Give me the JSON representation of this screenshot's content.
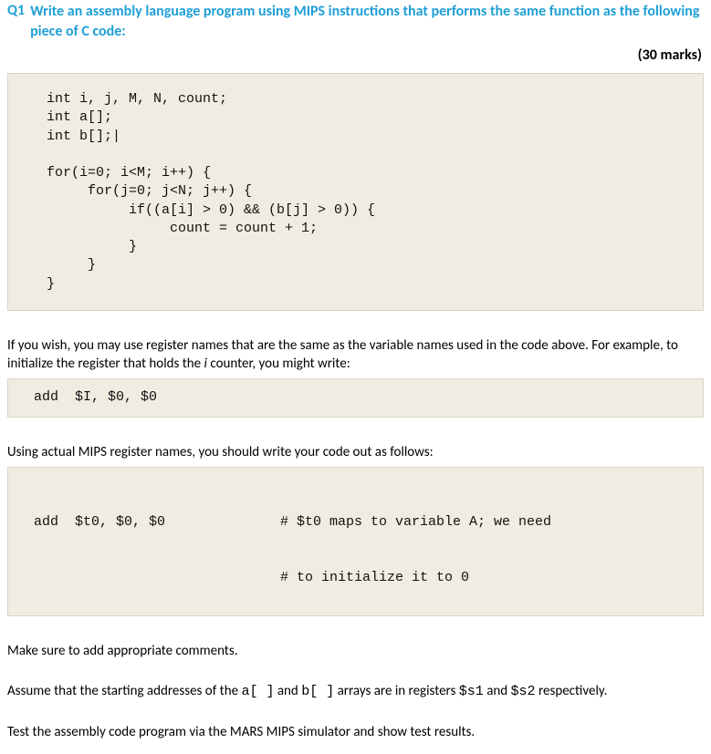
{
  "header": {
    "qnum": "Q1",
    "title": "Write an assembly language program using MIPS instructions that performs the same function as the following piece of C code:",
    "marks": "(30 marks)"
  },
  "code1": "int i, j, M, N, count;\nint a[];\nint b[];|\n\nfor(i=0; i<M; i++) {\n     for(j=0; j<N; j++) {\n          if((a[i] > 0) && (b[j] > 0)) {\n               count = count + 1;\n          }\n     }\n}",
  "para1a": "If you wish, you may use register names that are the same as the variable names used in the code above.  For example, to initialize the register that holds the ",
  "para1_i": "i",
  "para1b": " counter, you might write:",
  "code2": "add  $I, $0, $0",
  "para2": "Using actual MIPS register names, you should write your code out as follows:",
  "code3": {
    "left": "add  $t0, $0, $0",
    "right1": "# $t0 maps to variable A; we need",
    "right2": "# to initialize it to 0"
  },
  "para3": "Make sure to add appropriate comments.",
  "para4a": "Assume that the starting addresses of the ",
  "para4_arr1": "a[ ]",
  "para4_mid": " and ",
  "para4_arr2": "b[ ]",
  "para4b": " arrays are in registers ",
  "para4_reg1": "$s1",
  "para4_and": " and ",
  "para4_reg2": "$s2",
  "para4_end": " respectively.",
  "para5": "Test the assembly code program via the MARS MIPS simulator and show test results."
}
